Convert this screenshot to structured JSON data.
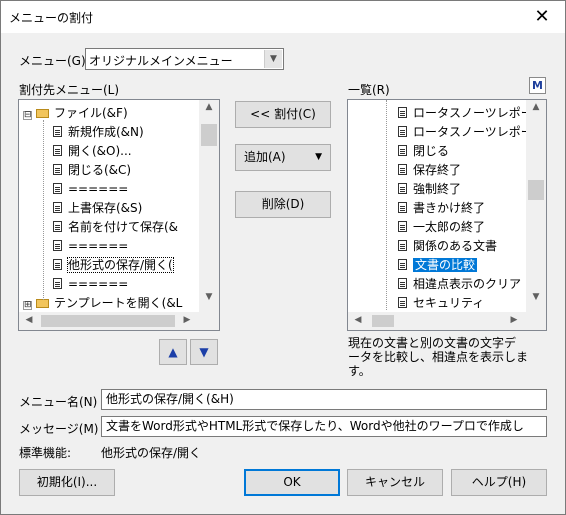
{
  "window": {
    "title": "メニューの割付",
    "close_glyph": "✕"
  },
  "menu": {
    "label": "メニュー(G)",
    "value": "オリジナルメインメニュー"
  },
  "left_panel": {
    "label": "割付先メニュー(L)",
    "items": [
      {
        "text": "ファイル(&F)",
        "kind": "folder",
        "expander": "⊟"
      },
      {
        "text": "新規作成(&N)",
        "kind": "doc"
      },
      {
        "text": "開く(&O)...",
        "kind": "doc"
      },
      {
        "text": "閉じる(&C)",
        "kind": "doc"
      },
      {
        "text": "======",
        "kind": "doc"
      },
      {
        "text": "上書保存(&S)",
        "kind": "doc"
      },
      {
        "text": "名前を付けて保存(&",
        "kind": "doc"
      },
      {
        "text": "======",
        "kind": "doc"
      },
      {
        "text": "他形式の保存/開く(",
        "kind": "doc",
        "state": "focused"
      },
      {
        "text": "======",
        "kind": "doc"
      },
      {
        "text": "テンプレートを開く(&L",
        "kind": "folder",
        "expander": "⊞"
      }
    ]
  },
  "middle": {
    "assign_button": "<< 割付(C)",
    "add_button": "追加(A)",
    "add_arrow": "▼",
    "delete_button": "削除(D)"
  },
  "right_panel": {
    "label": "一覧(R)",
    "m_badge": "M",
    "items": [
      {
        "text": "ロータスノーツレポート送"
      },
      {
        "text": "ロータスノーツレポート再"
      },
      {
        "text": "閉じる"
      },
      {
        "text": "保存終了"
      },
      {
        "text": "強制終了"
      },
      {
        "text": "書きかけ終了"
      },
      {
        "text": "一太郎の終了"
      },
      {
        "text": "関係のある文書"
      },
      {
        "text": "文書の比較",
        "state": "selected"
      },
      {
        "text": "相違点表示のクリア"
      },
      {
        "text": "セキュリティ"
      }
    ],
    "description": [
      "現在の文書と別の文書の文字デ",
      "ータを比較し、相違点を表示しま",
      "す。"
    ]
  },
  "move_buttons": {
    "up": "▲",
    "down": "▼"
  },
  "menu_name": {
    "label": "メニュー名(N)",
    "value": "他形式の保存/開く(&H)"
  },
  "message": {
    "label": "メッセージ(M)",
    "value": "文書をWord形式やHTML形式で保存したり、Wordや他社のワープロで作成し"
  },
  "standard_function": {
    "label": "標準機能:",
    "value": "他形式の保存/開く"
  },
  "footer": {
    "init_button": "初期化(I)...",
    "ok_button": "OK",
    "cancel_button": "キャンセル",
    "help_button": "ヘルプ(H)"
  },
  "colors": {
    "accent": "#0078d7",
    "selected_bg": "#0078d7",
    "up_down_arrow": "#1c3fa8"
  }
}
